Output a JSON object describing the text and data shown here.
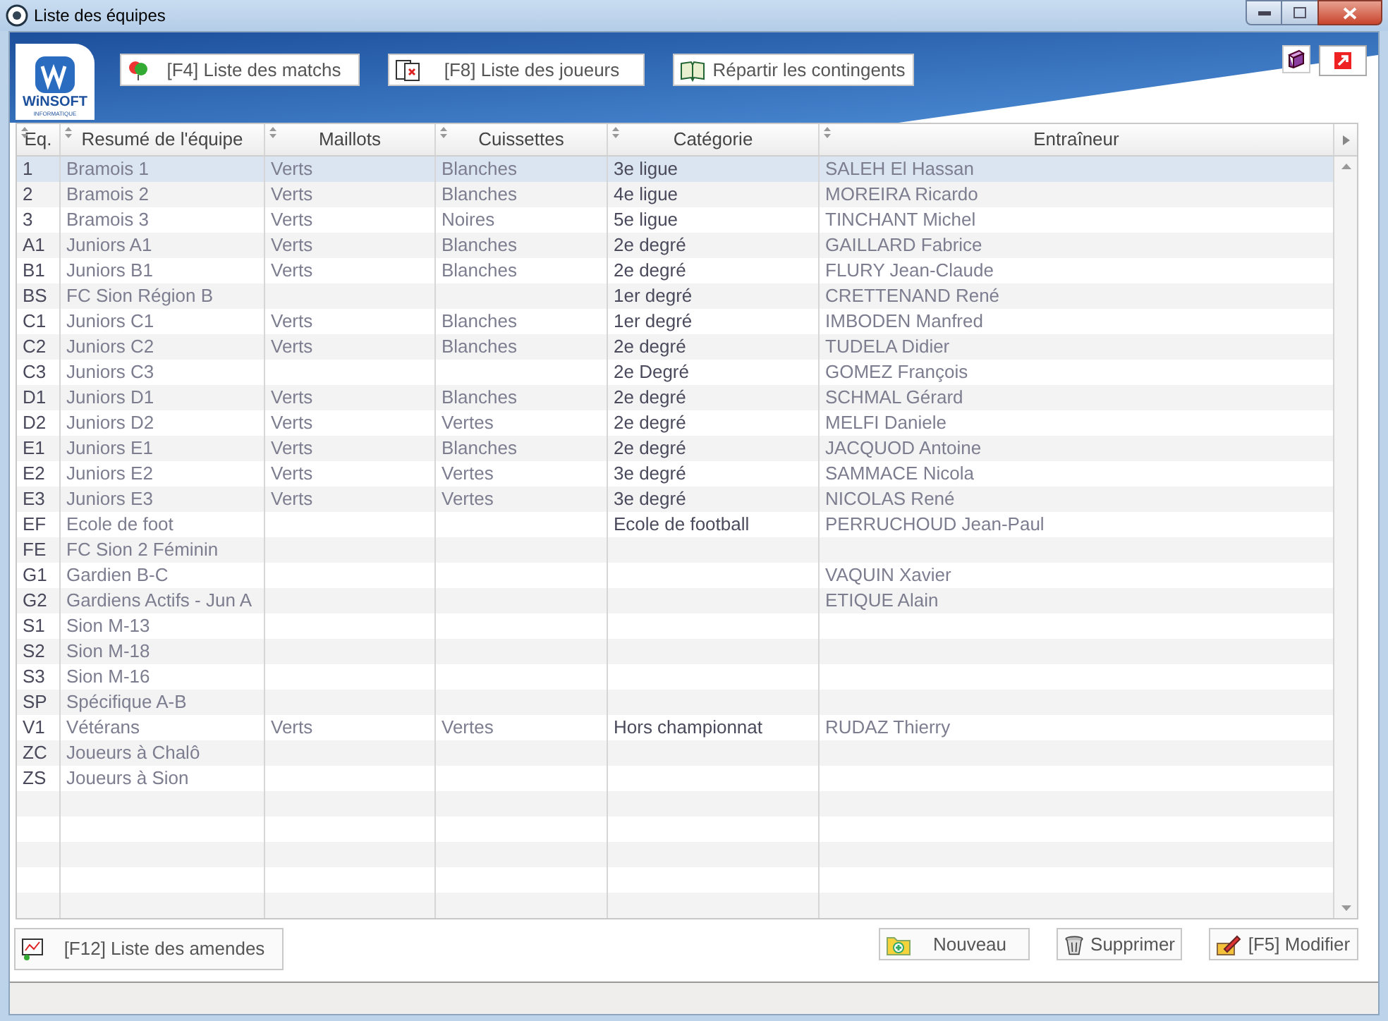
{
  "window": {
    "title": "Liste des équipes"
  },
  "logo": {
    "name": "WiNSOFT",
    "tagline": "INFORMATIQUE"
  },
  "toolbar": {
    "buttons": [
      {
        "label": "[F4] Liste des matchs"
      },
      {
        "label": "[F8] Liste des joueurs"
      },
      {
        "label": "Répartir les contingents"
      }
    ]
  },
  "table": {
    "columns": [
      "Eq.",
      "Resumé de l'équipe",
      "Maillots",
      "Cuissettes",
      "Catégorie",
      "Entraîneur"
    ],
    "rows": [
      {
        "selected": true,
        "cells": [
          "1",
          "Bramois 1",
          "Verts",
          "Blanches",
          "3e ligue",
          "SALEH El Hassan"
        ]
      },
      {
        "selected": false,
        "cells": [
          "2",
          "Bramois 2",
          "Verts",
          "Blanches",
          "4e ligue",
          "MOREIRA Ricardo"
        ]
      },
      {
        "selected": false,
        "cells": [
          "3",
          "Bramois 3",
          "Verts",
          "Noires",
          "5e ligue",
          "TINCHANT Michel"
        ]
      },
      {
        "selected": false,
        "cells": [
          "A1",
          "Juniors A1",
          "Verts",
          "Blanches",
          "2e degré",
          "GAILLARD Fabrice"
        ]
      },
      {
        "selected": false,
        "cells": [
          "B1",
          "Juniors B1",
          "Verts",
          "Blanches",
          "2e degré",
          "FLURY Jean-Claude"
        ]
      },
      {
        "selected": false,
        "cells": [
          "BS",
          "FC Sion Région B",
          null,
          null,
          "1er degré",
          "CRETTENAND René"
        ]
      },
      {
        "selected": false,
        "cells": [
          "C1",
          "Juniors C1",
          "Verts",
          "Blanches",
          "1er degré",
          "IMBODEN Manfred"
        ]
      },
      {
        "selected": false,
        "cells": [
          "C2",
          "Juniors C2",
          "Verts",
          "Blanches",
          "2e degré",
          "TUDELA Didier"
        ]
      },
      {
        "selected": false,
        "cells": [
          "C3",
          "Juniors C3",
          null,
          null,
          "2e Degré",
          "GOMEZ François"
        ]
      },
      {
        "selected": false,
        "cells": [
          "D1",
          "Juniors D1",
          "Verts",
          "Blanches",
          "2e degré",
          "SCHMAL Gérard"
        ]
      },
      {
        "selected": false,
        "cells": [
          "D2",
          "Juniors D2",
          "Verts",
          "Vertes",
          "2e degré",
          "MELFI Daniele"
        ]
      },
      {
        "selected": false,
        "cells": [
          "E1",
          "Juniors E1",
          "Verts",
          "Blanches",
          "2e degré",
          "JACQUOD Antoine"
        ]
      },
      {
        "selected": false,
        "cells": [
          "E2",
          "Juniors E2",
          "Verts",
          "Vertes",
          "3e degré",
          "SAMMACE Nicola"
        ]
      },
      {
        "selected": false,
        "cells": [
          "E3",
          "Juniors E3",
          "Verts",
          "Vertes",
          "3e degré",
          "NICOLAS René"
        ]
      },
      {
        "selected": false,
        "cells": [
          "EF",
          "Ecole de foot",
          null,
          null,
          "Ecole de football",
          "PERRUCHOUD Jean-Paul"
        ]
      },
      {
        "selected": false,
        "cells": [
          "FE",
          "FC Sion 2 Féminin",
          null,
          null,
          null,
          null
        ]
      },
      {
        "selected": false,
        "cells": [
          "G1",
          "Gardien B-C",
          null,
          null,
          null,
          "VAQUIN Xavier"
        ]
      },
      {
        "selected": false,
        "cells": [
          "G2",
          "Gardiens Actifs - Jun A",
          null,
          null,
          null,
          "ETIQUE Alain"
        ]
      },
      {
        "selected": false,
        "cells": [
          "S1",
          "Sion M-13",
          null,
          null,
          null,
          null
        ]
      },
      {
        "selected": false,
        "cells": [
          "S2",
          "Sion M-18",
          null,
          null,
          null,
          null
        ]
      },
      {
        "selected": false,
        "cells": [
          "S3",
          "Sion M-16",
          null,
          null,
          null,
          null
        ]
      },
      {
        "selected": false,
        "cells": [
          "SP",
          "Spécifique A-B",
          null,
          null,
          null,
          null
        ]
      },
      {
        "selected": false,
        "cells": [
          "V1",
          "Vétérans",
          "Verts",
          "Vertes",
          "Hors championnat",
          "RUDAZ Thierry"
        ]
      },
      {
        "selected": false,
        "cells": [
          "ZC",
          "Joueurs à Chalô",
          null,
          null,
          null,
          null
        ]
      },
      {
        "selected": false,
        "cells": [
          "ZS",
          "Joueurs à Sion",
          null,
          null,
          null,
          null
        ]
      }
    ]
  },
  "footer": {
    "left_button": {
      "label": "[F12] Liste des amendes"
    },
    "buttons": [
      {
        "label": "Nouveau"
      },
      {
        "label": "Supprimer"
      },
      {
        "label": "[F5] Modifier"
      }
    ]
  }
}
